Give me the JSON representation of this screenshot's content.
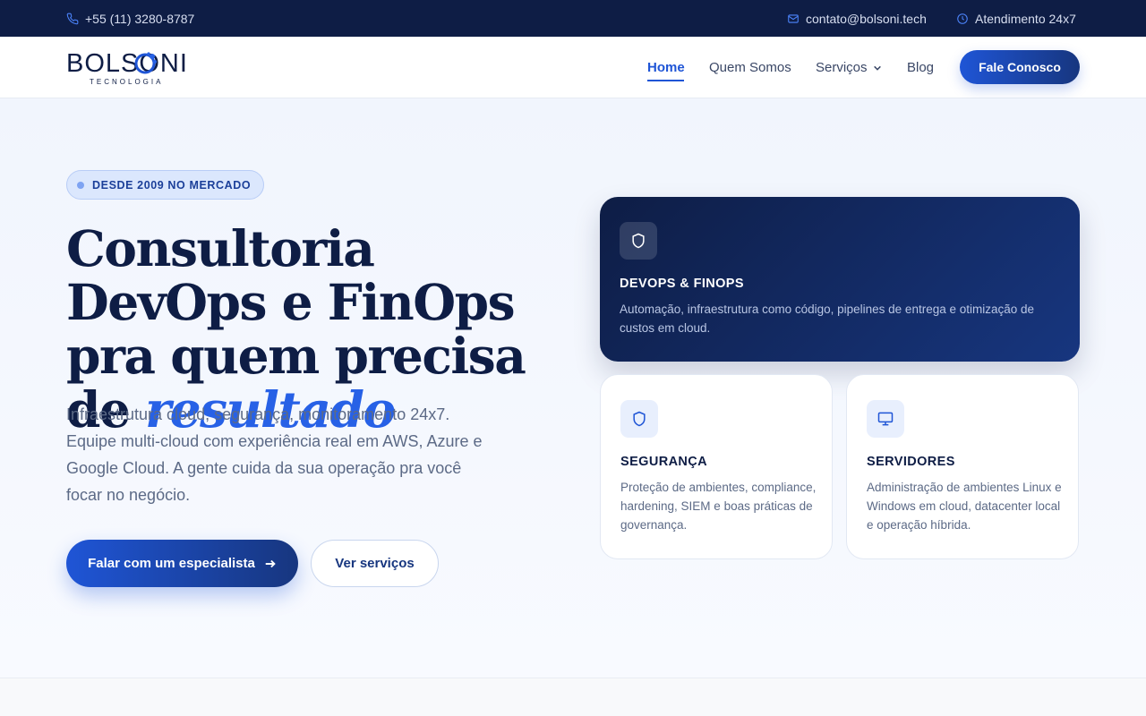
{
  "topbar": {
    "phone": "+55 (11) 3280-8787",
    "email": "contato@bolsoni.tech",
    "hours": "Atendimento 24x7"
  },
  "brand": {
    "name": "BOLSONI",
    "tagline": "TECNOLOGIA",
    "colors": {
      "navy": "#0e1d45",
      "blue": "#1f55d6",
      "accent": "#2761e6"
    }
  },
  "nav": {
    "items": [
      "Home",
      "Quem Somos",
      "Serviços",
      "Blog"
    ],
    "active": "Home",
    "cta": "Fale Conosco"
  },
  "hero": {
    "badge": "DESDE 2009 NO MERCADO",
    "headline_plain": "Consultoria DevOps e FinOps pra quem precisa de",
    "headline_accent": "resultado",
    "lead": "Infraestrutura cloud, segurança, monitoramento 24x7. Equipe multi-cloud com experiência real em AWS, Azure e Google Cloud. A gente cuida da sua operação pra você focar no negócio.",
    "primary_cta": "Falar com um especialista",
    "secondary_cta": "Ver serviços"
  },
  "cards": [
    {
      "icon": "shield-icon",
      "title": "DEVOPS & FINOPS",
      "desc": "Automação, infraestrutura como código, pipelines de entrega e otimização de custos em cloud."
    },
    {
      "icon": "shield-icon",
      "title": "SEGURANÇA",
      "desc": "Proteção de ambientes, compliance, hardening, SIEM e boas práticas de governança."
    },
    {
      "icon": "monitor-icon",
      "title": "SERVIDORES",
      "desc": "Administração de ambientes Linux e Windows em cloud, datacenter local e operação híbrida."
    }
  ]
}
